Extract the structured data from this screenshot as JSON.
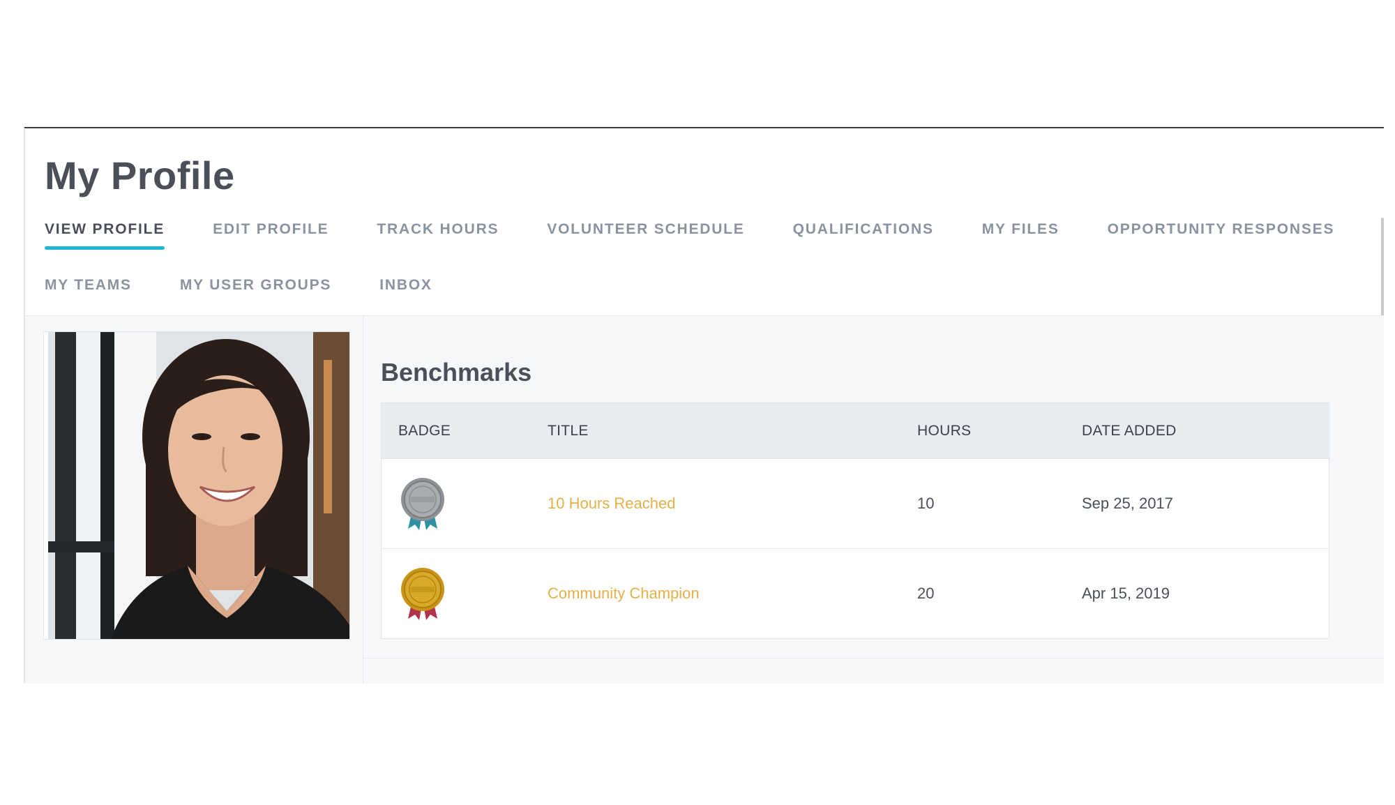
{
  "page": {
    "title": "My Profile"
  },
  "tabs": {
    "row1": [
      {
        "label": "VIEW PROFILE",
        "active": true
      },
      {
        "label": "EDIT PROFILE",
        "active": false
      },
      {
        "label": "TRACK HOURS",
        "active": false
      },
      {
        "label": "VOLUNTEER SCHEDULE",
        "active": false
      },
      {
        "label": "QUALIFICATIONS",
        "active": false
      },
      {
        "label": "MY FILES",
        "active": false
      },
      {
        "label": "OPPORTUNITY RESPONSES",
        "active": false
      }
    ],
    "row2": [
      {
        "label": "MY TEAMS",
        "active": false
      },
      {
        "label": "MY USER GROUPS",
        "active": false
      },
      {
        "label": "INBOX",
        "active": false
      }
    ]
  },
  "profile_photo": {
    "icon": "profile-photo"
  },
  "benchmarks": {
    "title": "Benchmarks",
    "columns": {
      "badge": "BADGE",
      "title": "TITLE",
      "hours": "HOURS",
      "date_added": "DATE ADDED"
    },
    "rows": [
      {
        "badge_icon": "silver-medal-icon",
        "title": "10 Hours Reached",
        "hours": "10",
        "date_added": "Sep 25, 2017"
      },
      {
        "badge_icon": "gold-medal-icon",
        "title": "Community Champion",
        "hours": "20",
        "date_added": "Apr 15, 2019"
      }
    ]
  },
  "colors": {
    "accent": "#1fb5d6",
    "link": "#e4b04a",
    "heading": "#4a4f5a",
    "tab_inactive": "#8a93a0",
    "table_header_bg": "#e9ecf0",
    "content_bg": "#f6f7f9"
  }
}
